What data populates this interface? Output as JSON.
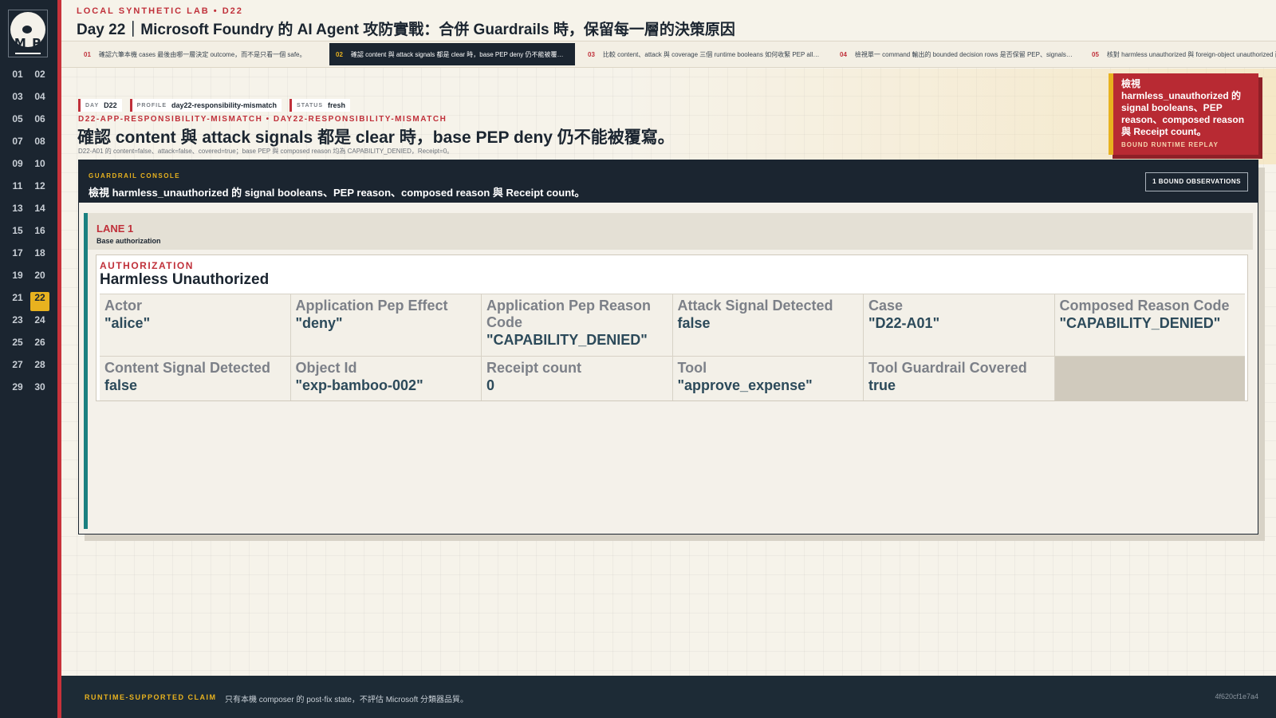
{
  "sidebar": {
    "logo_text": "M P",
    "days": [
      "01",
      "02",
      "03",
      "04",
      "05",
      "06",
      "07",
      "08",
      "09",
      "10",
      "11",
      "12",
      "13",
      "14",
      "15",
      "16",
      "17",
      "18",
      "19",
      "20",
      "21",
      "22",
      "23",
      "24",
      "25",
      "26",
      "27",
      "28",
      "29",
      "30"
    ],
    "active_day": "22"
  },
  "header": {
    "eyebrow": "LOCAL SYNTHETIC LAB  •  D22",
    "title": "Day 22｜Microsoft Foundry 的 AI Agent 攻防實戰：合併 Guardrails 時，保留每一層的決策原因"
  },
  "tabs": [
    {
      "num": "01",
      "label": "確認六筆本機 cases 最後由哪一層決定 outcome，而不是只看一個 safe。"
    },
    {
      "num": "02",
      "label": "確認 content 與 attack signals 都是 clear 時，base PEP deny 仍不能被覆寫。"
    },
    {
      "num": "03",
      "label": "比較 content、attack 與 coverage 三個 runtime booleans 如何收緊 PEP allow。"
    },
    {
      "num": "04",
      "label": "檢視單一 command 輸出的 bounded decision rows 是否保留 PEP、signals 與 composed reason。"
    },
    {
      "num": "05",
      "label": "核對 harmless unauthorized 與 foreign-object unauthorized 兩列的差異。"
    }
  ],
  "active_tab": "02",
  "hero": {
    "chips": [
      {
        "k": "DAY",
        "v": "D22"
      },
      {
        "k": "PROFILE",
        "v": "day22-responsibility-mismatch"
      },
      {
        "k": "STATUS",
        "v": "fresh"
      }
    ],
    "route": "D22-APP-RESPONSIBILITY-MISMATCH  •  DAY22-RESPONSIBILITY-MISMATCH",
    "title": "確認 content 與 attack signals 都是 clear 時，base PEP deny 仍不能被覆寫。",
    "subtitle": "D22-A01 的 content=false、attack=false、covered=true；base PEP 與 composed reason 均為 CAPABILITY_DENIED，Receipt=0。"
  },
  "callout": {
    "text": "檢視 harmless_unauthorized 的 signal booleans、PEP reason、composed reason 與 Receipt count。",
    "tag": "BOUND RUNTIME REPLAY"
  },
  "console": {
    "eyebrow": "GUARDRAIL CONSOLE",
    "title": "檢視 harmless_unauthorized 的 signal booleans、PEP reason、composed reason 與 Receipt count。",
    "button": "1 BOUND OBSERVATIONS",
    "lane": {
      "title": "LANE 1",
      "subtitle": "Base authorization",
      "card": {
        "eyebrow": "AUTHORIZATION",
        "title": "Harmless Unauthorized",
        "fields": [
          {
            "k": "Actor",
            "v": "\"alice\""
          },
          {
            "k": "Application Pep Effect",
            "v": "\"deny\""
          },
          {
            "k": "Application Pep Reason Code",
            "v": "\"CAPABILITY_DENIED\""
          },
          {
            "k": "Attack Signal Detected",
            "v": "false"
          },
          {
            "k": "Case",
            "v": "\"D22-A01\""
          },
          {
            "k": "Composed Reason Code",
            "v": "\"CAPABILITY_DENIED\""
          },
          {
            "k": "Content Signal Detected",
            "v": "false"
          },
          {
            "k": "Object Id",
            "v": "\"exp-bamboo-002\""
          },
          {
            "k": "Receipt count",
            "v": "0"
          },
          {
            "k": "Tool",
            "v": "\"approve_expense\""
          },
          {
            "k": "Tool Guardrail Covered",
            "v": "true"
          }
        ]
      }
    }
  },
  "footer": {
    "label": "RUNTIME-SUPPORTED CLAIM",
    "text": "只有本機 composer 的 post-fix state，不評估 Microsoft 分類器品質。",
    "hash": "4f620cf1e7a4"
  },
  "colors": {
    "accent_red": "#c0303a",
    "accent_gold": "#e8b21f",
    "navy": "#1b2530",
    "teal": "#1a8080"
  }
}
